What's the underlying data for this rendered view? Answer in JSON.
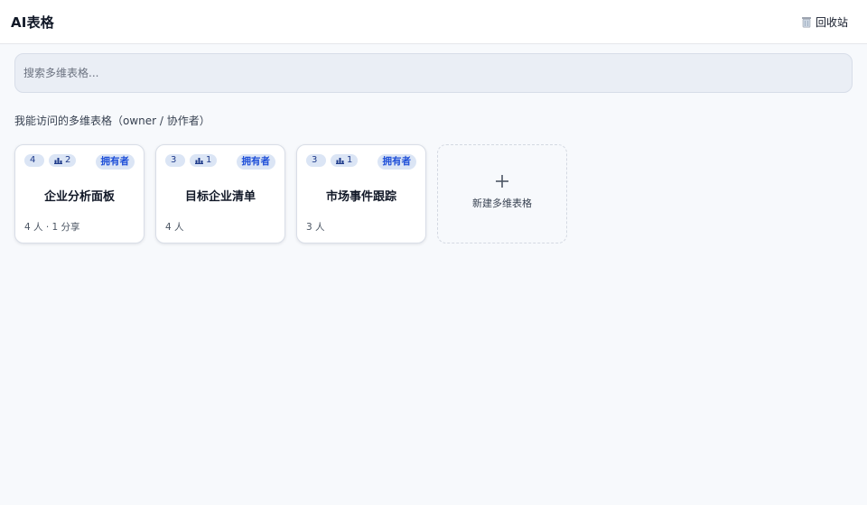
{
  "app": {
    "title": "AI表格"
  },
  "header": {
    "trash_label": "回收站"
  },
  "search": {
    "placeholder": "搜索多维表格..."
  },
  "section": {
    "title": "我能访问的多维表格（owner / 协作者）"
  },
  "cards": [
    {
      "count": "4",
      "bar_count": "2",
      "badge": "拥有者",
      "name": "企业分析面板",
      "meta": "4 人 · 1 分享"
    },
    {
      "count": "3",
      "bar_count": "1",
      "badge": "拥有者",
      "name": "目标企业清单",
      "meta": "4 人"
    },
    {
      "count": "3",
      "bar_count": "1",
      "badge": "拥有者",
      "name": "市场事件跟踪",
      "meta": "3 人"
    }
  ],
  "new_card": {
    "label": "新建多维表格"
  },
  "icons": {
    "trash": "trash-icon",
    "bar": "bar-chart-icon",
    "plus": "plus-icon"
  },
  "colors": {
    "accent": "#1d4ed8",
    "chip_bg": "#dbe5f5",
    "page_bg": "#f7f9fc"
  }
}
